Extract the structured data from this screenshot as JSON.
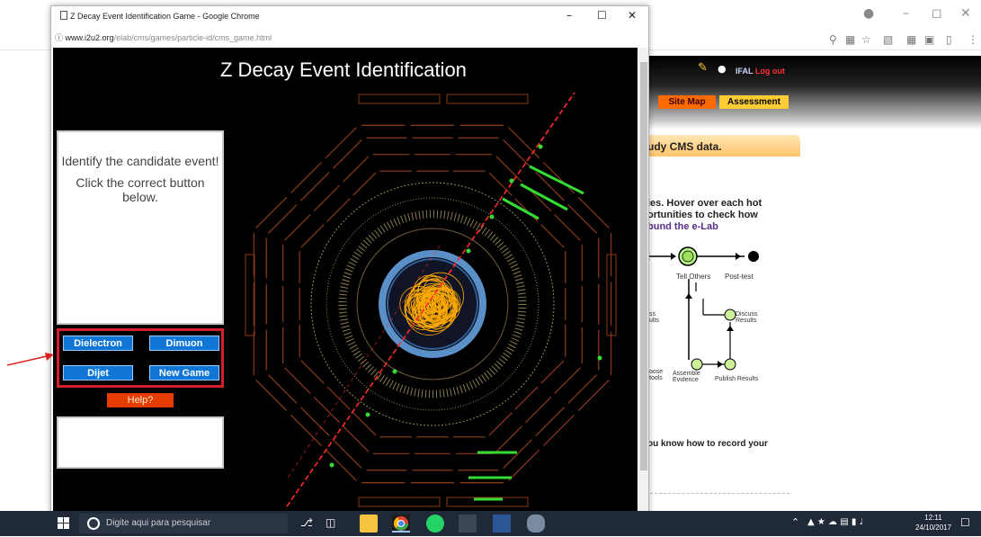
{
  "popup": {
    "title": "Z Decay Event Identification Game - Google Chrome",
    "url_host": "www.i2u2.org",
    "url_path": "/elab/cms/games/particle-id/cms_game.html",
    "window_controls": [
      "–",
      "☐",
      "✕"
    ]
  },
  "game": {
    "title": "Z Decay Event Identification",
    "instructions": [
      "Identify the candidate event!",
      "Click the correct button below."
    ],
    "buttons": {
      "dielectron": "Dielectron",
      "dimuon": "Dimuon",
      "dijet": "Dijet",
      "new_game": "New Game",
      "help": "Help?"
    },
    "output_text": ""
  },
  "background_page": {
    "logo_text": "IFAL",
    "logout": "Log out",
    "nav": [
      "Site Map",
      "Assessment"
    ],
    "heading": "udy CMS data.",
    "lines": [
      "ies. Hover over each hot",
      "ortunities to check how"
    ],
    "link": "bund the e-Lab",
    "diagram": {
      "tell_others": "Tell Others",
      "post_test": "Post-test",
      "discuss": "Discuss Results",
      "assemble": "Assemble Evidence",
      "publish": "Publish Results",
      "left_top": "ss ults",
      "left_bottom": "oose tools"
    },
    "bottom_text": "ou know how to record your"
  },
  "taskbar": {
    "search_placeholder": "Digite aqui para pesquisar",
    "time": "12:11",
    "date": "24/10/2017"
  },
  "colors": {
    "dielectron_track": "#ff2a2a",
    "calorimeter_line": "#8b3a1a",
    "energy_deposit": "#33dd33",
    "detector_ring": "#5b8fc7",
    "annotation_arrow": "#e02020"
  }
}
